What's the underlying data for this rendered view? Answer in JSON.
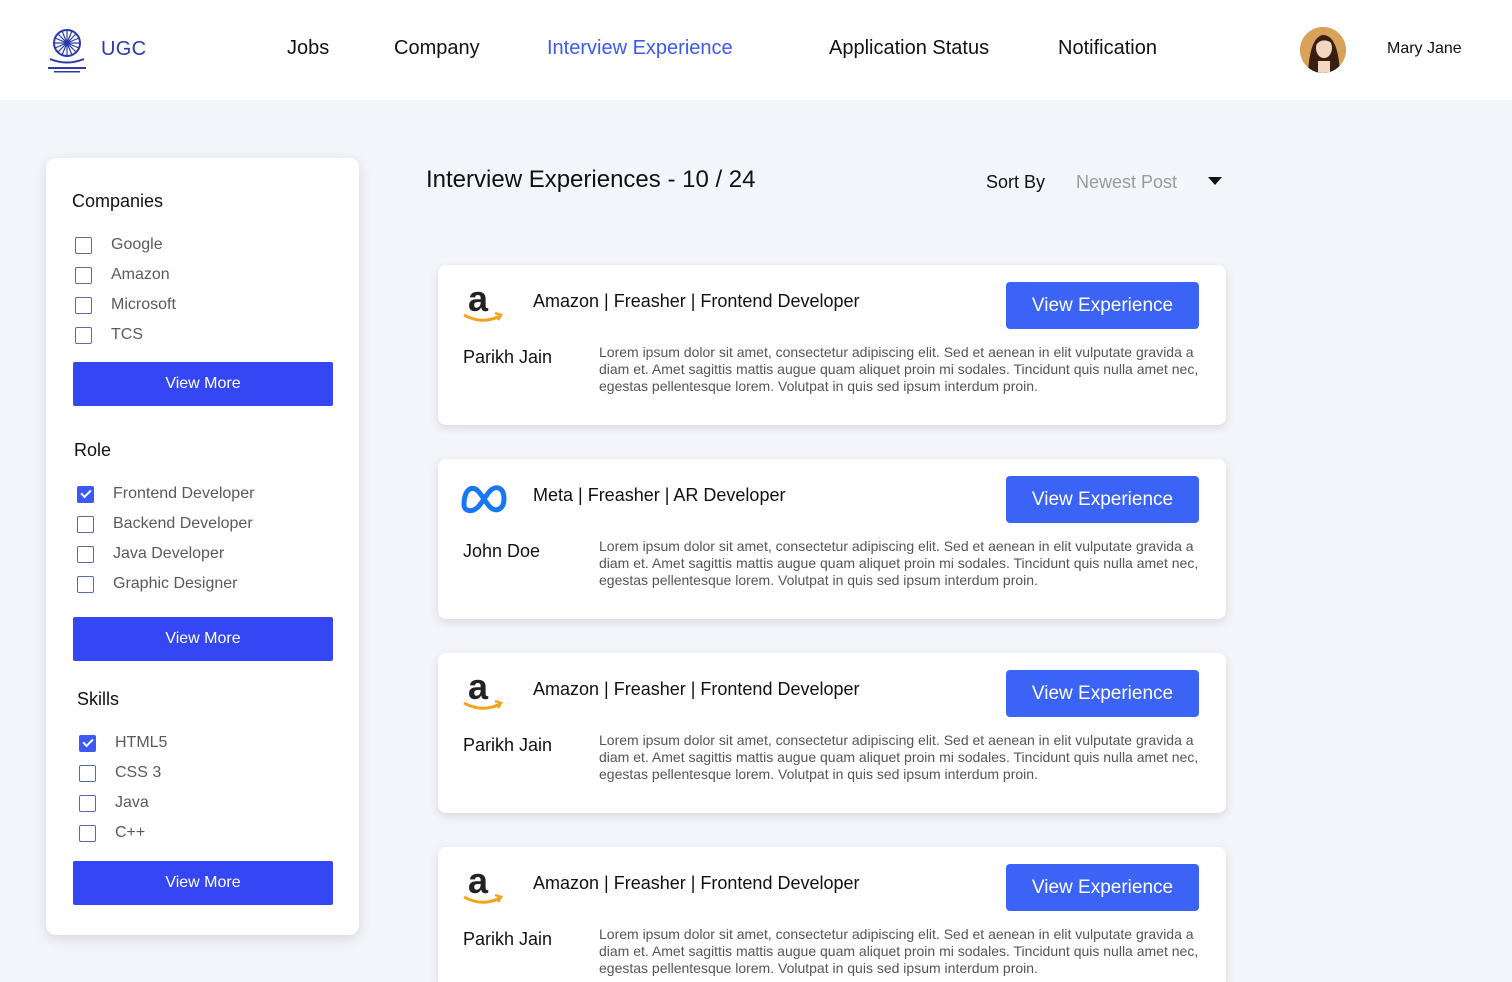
{
  "header": {
    "brand": "UGC",
    "nav": [
      "Jobs",
      "Company",
      "Interview Experience",
      "Application Status",
      "Notification"
    ],
    "active_nav": "Interview Experience",
    "user_name": "Mary Jane"
  },
  "sidebar": {
    "companies": {
      "title": "Companies",
      "items": [
        {
          "label": "Google",
          "checked": false
        },
        {
          "label": "Amazon",
          "checked": false
        },
        {
          "label": "Microsoft",
          "checked": false
        },
        {
          "label": "TCS",
          "checked": false
        }
      ],
      "button": "View More"
    },
    "role": {
      "title": "Role",
      "items": [
        {
          "label": "Frontend Developer",
          "checked": true
        },
        {
          "label": "Backend Developer",
          "checked": false
        },
        {
          "label": "Java Developer",
          "checked": false
        },
        {
          "label": "Graphic Designer",
          "checked": false
        }
      ],
      "button": "View More"
    },
    "skills": {
      "title": "Skills",
      "items": [
        {
          "label": "HTML5",
          "checked": true
        },
        {
          "label": "CSS 3",
          "checked": false
        },
        {
          "label": "Java",
          "checked": false
        },
        {
          "label": "C++",
          "checked": false
        }
      ],
      "button": "View More"
    }
  },
  "main": {
    "title": "Interview Experiences - 10 / 24",
    "sort_label": "Sort By",
    "sort_value": "Newest Post",
    "cards": [
      {
        "logo": "amazon-logo",
        "title": "Amazon | Freasher | Frontend Developer",
        "author": "Parikh Jain",
        "description": "Lorem ipsum dolor sit amet, consectetur adipiscing elit. Sed et aenean in elit vulputate gravida a diam et. Amet sagittis mattis augue quam aliquet proin mi sodales. Tincidunt quis nulla amet nec, egestas pellentesque lorem. Volutpat in quis sed ipsum interdum proin.",
        "button": "View Experience"
      },
      {
        "logo": "meta-logo",
        "title": "Meta | Freasher | AR Developer",
        "author": "John Doe",
        "description": "Lorem ipsum dolor sit amet, consectetur adipiscing elit. Sed et aenean in elit vulputate gravida a diam et. Amet sagittis mattis augue quam aliquet proin mi sodales. Tincidunt quis nulla amet nec, egestas pellentesque lorem. Volutpat in quis sed ipsum interdum proin.",
        "button": "View Experience"
      },
      {
        "logo": "amazon-logo",
        "title": "Amazon | Freasher | Frontend Developer",
        "author": "Parikh Jain",
        "description": "Lorem ipsum dolor sit amet, consectetur adipiscing elit. Sed et aenean in elit vulputate gravida a diam et. Amet sagittis mattis augue quam aliquet proin mi sodales. Tincidunt quis nulla amet nec, egestas pellentesque lorem. Volutpat in quis sed ipsum interdum proin.",
        "button": "View Experience"
      },
      {
        "logo": "amazon-logo",
        "title": "Amazon | Freasher | Frontend Developer",
        "author": "Parikh Jain",
        "description": "Lorem ipsum dolor sit amet, consectetur adipiscing elit. Sed et aenean in elit vulputate gravida a diam et. Amet sagittis mattis augue quam aliquet proin mi sodales. Tincidunt quis nulla amet nec, egestas pellentesque lorem. Volutpat in quis sed ipsum interdum proin.",
        "button": "View Experience"
      }
    ]
  },
  "colors": {
    "accent": "#3b59f5",
    "button": "#3546f5",
    "background": "#f4f5fb",
    "brand": "#2b3aa8"
  }
}
